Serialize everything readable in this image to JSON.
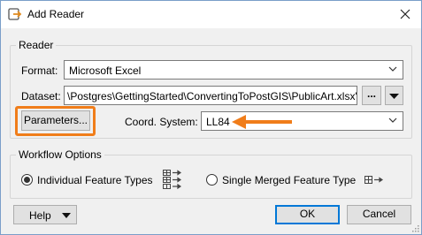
{
  "window": {
    "title": "Add Reader"
  },
  "reader_group": {
    "title": "Reader"
  },
  "format": {
    "label": "Format:",
    "value": "Microsoft Excel"
  },
  "dataset": {
    "label": "Dataset:",
    "value": "\\Postgres\\GettingStarted\\ConvertingToPostGIS\\PublicArt.xlsx\"",
    "browse_label": "..."
  },
  "parameters": {
    "label": "Parameters..."
  },
  "coord": {
    "label": "Coord. System:",
    "value": "LL84"
  },
  "workflow": {
    "title": "Workflow Options",
    "individual_label": "Individual Feature Types",
    "merged_label": "Single Merged Feature Type",
    "selected": "individual"
  },
  "footer": {
    "help_label": "Help",
    "ok_label": "OK",
    "cancel_label": "Cancel"
  },
  "colors": {
    "highlight": "#f07d1a",
    "focus": "#0078d7"
  }
}
